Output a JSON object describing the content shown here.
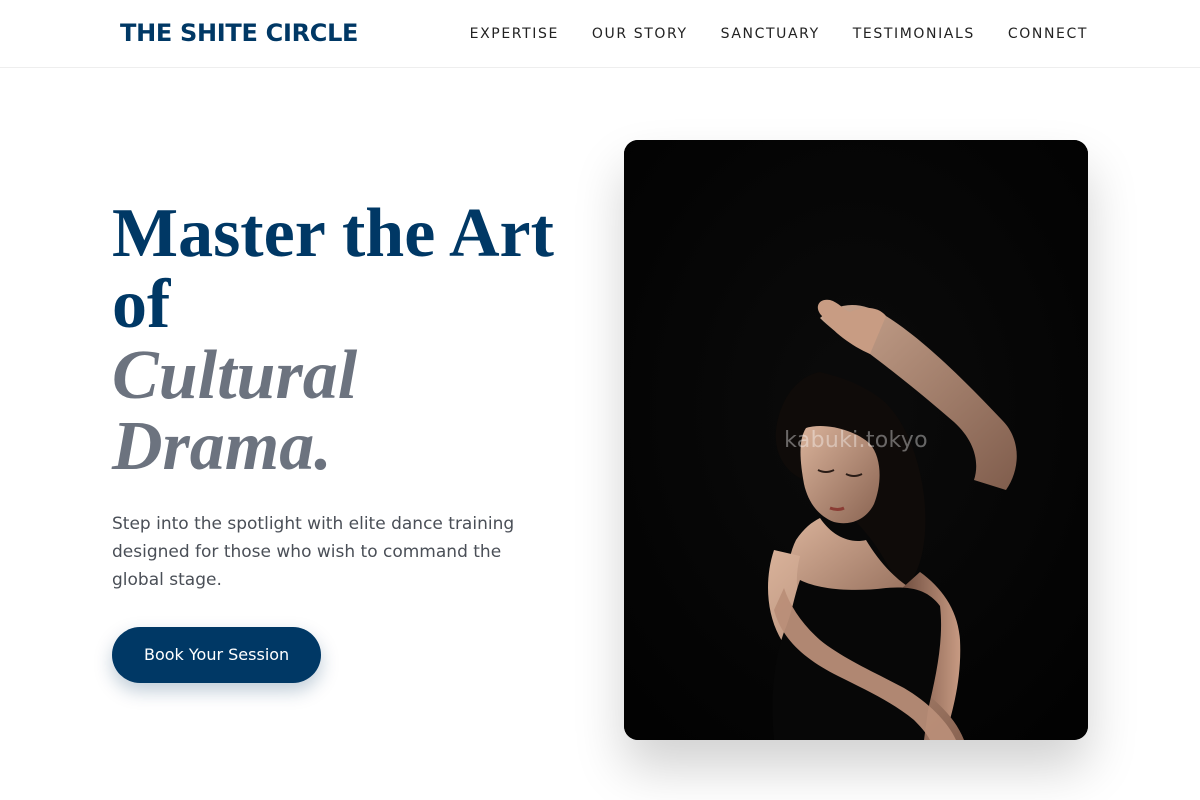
{
  "brand": {
    "name": "THE SHITE CIRCLE"
  },
  "nav": {
    "items": [
      {
        "label": "EXPERTISE"
      },
      {
        "label": "OUR STORY"
      },
      {
        "label": "SANCTUARY"
      },
      {
        "label": "TESTIMONIALS"
      },
      {
        "label": "CONNECT"
      }
    ]
  },
  "hero": {
    "headline_main": "Master the Art of",
    "headline_accent": "Cultural Drama.",
    "subtext": "Step into the spotlight with elite dance training designed for those who wish to command the global stage.",
    "cta_label": "Book Your Session"
  },
  "image": {
    "watermark": "kabuki.tokyo",
    "subject": "dancer-photo"
  },
  "colors": {
    "brand_navy": "#003865",
    "accent_gray": "#6c737f",
    "body_text": "#4a4f57"
  }
}
